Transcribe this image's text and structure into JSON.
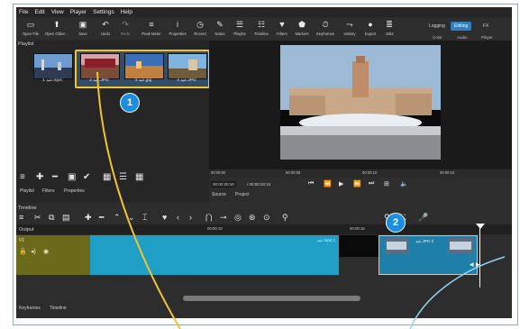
{
  "menu": [
    "File",
    "Edit",
    "View",
    "Player",
    "Settings",
    "Help"
  ],
  "toolbar": {
    "buttons": [
      {
        "label": "Open File",
        "icon": "folder-icon"
      },
      {
        "label": "Open Other…",
        "icon": "open-other-icon"
      },
      {
        "label": "Save",
        "icon": "save-icon"
      },
      {
        "label": "Undo",
        "icon": "undo-icon"
      },
      {
        "label": "Redo",
        "icon": "redo-icon"
      },
      {
        "label": "Peak Meter",
        "icon": "peak-meter-icon"
      },
      {
        "label": "Properties",
        "icon": "info-icon"
      },
      {
        "label": "Recent",
        "icon": "clock-icon"
      },
      {
        "label": "Notes",
        "icon": "notes-icon"
      },
      {
        "label": "Playlist",
        "icon": "list-icon"
      },
      {
        "label": "Timeline",
        "icon": "timeline-icon"
      },
      {
        "label": "Filters",
        "icon": "filter-icon"
      },
      {
        "label": "Markers",
        "icon": "marker-icon"
      },
      {
        "label": "Keyframes",
        "icon": "stopwatch-icon"
      },
      {
        "label": "History",
        "icon": "history-icon"
      },
      {
        "label": "Export",
        "icon": "export-icon"
      },
      {
        "label": "Jobs",
        "icon": "jobs-icon"
      }
    ],
    "layouts": [
      "Logging",
      "Editing",
      "FX"
    ],
    "active_layout": "Editing",
    "layout_sub": [
      "Color",
      "Audio",
      "Player"
    ]
  },
  "playlist": {
    "title": "Playlist",
    "items": [
      {
        "caption": "1 عيد.mp4"
      },
      {
        "caption": "2 عيد.JPG"
      },
      {
        "caption": "3 عيد.jpg"
      },
      {
        "caption": "4 عيد.JPG"
      }
    ],
    "tabs": [
      "Playlist",
      "Filters",
      "Properties"
    ]
  },
  "viewer": {
    "ruler_marks": [
      "00:00:00",
      "00:00:05",
      "00:00:10",
      "00:00:15"
    ],
    "timecode_current": "00:00:20:10",
    "timecode_total": "/ 00:00:20:10",
    "tabs": [
      "Source",
      "Project"
    ]
  },
  "timeline": {
    "title": "Timeline",
    "output_label": "Output",
    "track_label": "V1",
    "ruler_marks": [
      "00:00:10",
      "00:00:15"
    ],
    "clip_label": "عيد.mp4 1",
    "clip2_label": "عيد.JPG 2",
    "bottom_tabs": [
      "Keyframes",
      "Timeline"
    ]
  },
  "callouts": [
    "1",
    "2"
  ],
  "colors": {
    "accent_blue": "#2f7fc1",
    "highlight_yellow": "#f2c230",
    "clip_cyan": "#1f9fc6",
    "track_olive": "#6b6a1a"
  }
}
